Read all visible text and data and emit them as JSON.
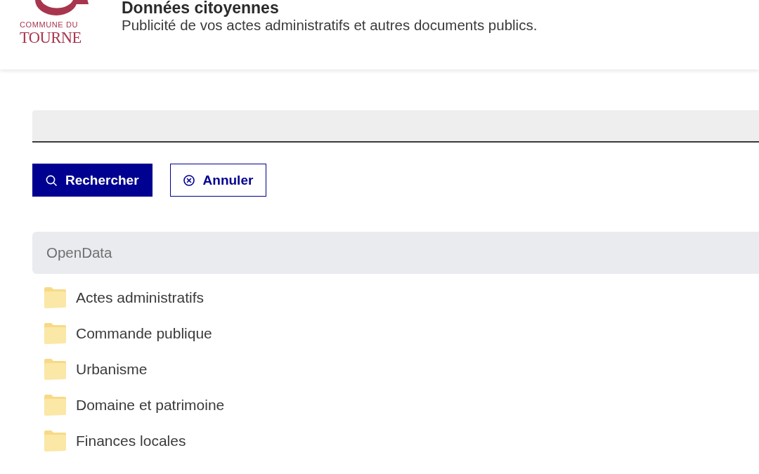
{
  "header": {
    "logo": {
      "line_1": "COMMUNE DU",
      "line_2": "TOURNE"
    },
    "title": "Données citoyennes",
    "subtitle": "Publicité de vos actes administratifs et autres documents publics."
  },
  "buttons": [
    {
      "label": "Rechercher",
      "kind": "primary"
    },
    {
      "label": "Annuler",
      "kind": "secondary"
    }
  ],
  "folder_list": {
    "heading": "OpenData",
    "items": [
      {
        "label": "Actes administratifs"
      },
      {
        "label": "Commande publique"
      },
      {
        "label": "Urbanisme"
      },
      {
        "label": "Domaine et patrimoine"
      },
      {
        "label": "Finances locales"
      }
    ]
  }
}
